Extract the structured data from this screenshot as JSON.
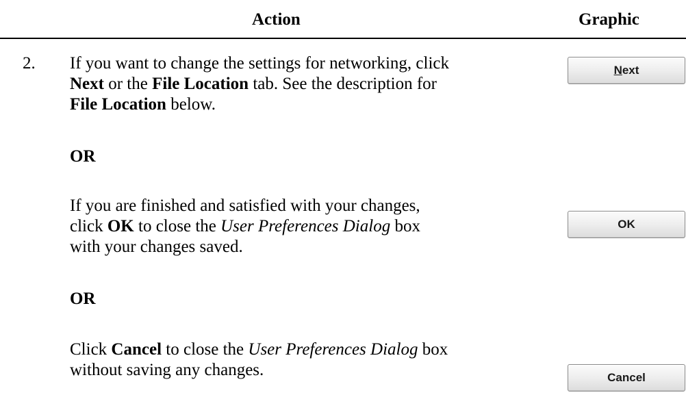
{
  "header": {
    "action": "Action",
    "graphic": "Graphic"
  },
  "step": {
    "number": "2.",
    "para1": {
      "t1": "If you want to change the settings for networking, click ",
      "b1": "Next",
      "t2": " or the ",
      "b2": "File Location",
      "t3": " tab.  See the description for ",
      "b3": "File Location",
      "t4": " below."
    },
    "or1": "OR",
    "para2": {
      "t1": "If you are finished and satisfied with your changes, click ",
      "b1": "OK",
      "t2": " to close the ",
      "i1": "User Preferences Dialog",
      "t3": " box with your changes saved."
    },
    "or2": "OR",
    "para3": {
      "t1": "Click ",
      "b1": "Cancel",
      "t2": " to close the ",
      "i1": "User Preferences Dialog",
      "t3": " box without saving any changes."
    }
  },
  "buttons": {
    "next": {
      "mnemonic": "N",
      "rest": "ext"
    },
    "ok": "OK",
    "cancel": "Cancel"
  }
}
